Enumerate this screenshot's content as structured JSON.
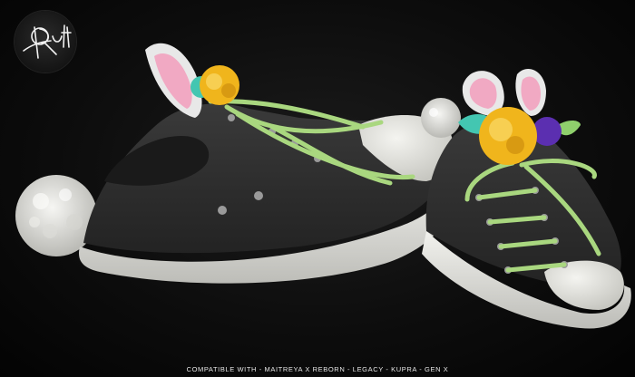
{
  "caption": "COMPATIBLE WITH - MAITREYA X  REBORN - LEGACY - KUPRA - GEN X",
  "colors": {
    "background": "#0d0d0d",
    "canvas": "#2b2b2b",
    "sole": "#e4e4df",
    "lace": "#a9d77f",
    "ear_inner": "#f1a9c3",
    "flower_yellow": "#f0b51c",
    "flower_purple": "#5b2fb0",
    "leaf_teal": "#43c6b1",
    "pompom": "#e9e9e6"
  },
  "icons": {
    "logo": "signature-logo-icon"
  }
}
